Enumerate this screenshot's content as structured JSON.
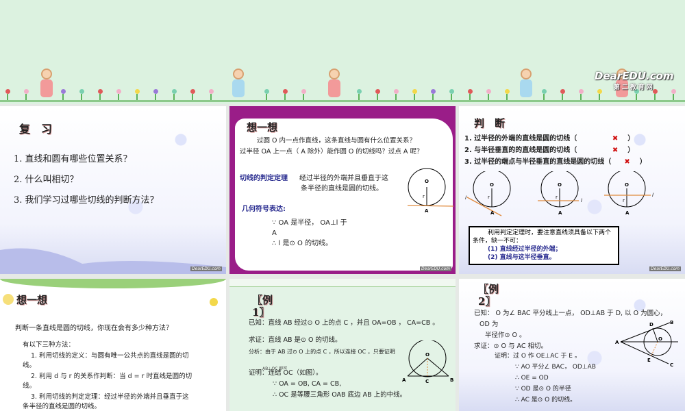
{
  "banner": {
    "logo": "DearEDU.com",
    "logo_sub": "第二教育网"
  },
  "slide1": {
    "title": "复　习",
    "items": [
      "1. 直线和圆有哪些位置关系？",
      "2. 什么叫相切？",
      "3. 我们学习过哪些切线的判断方法？"
    ]
  },
  "slide2": {
    "title": "想一想",
    "q1": "过圆 O 内一点作直线，这条直线与圆有什么位置关系？",
    "q2": "过半径 OA 上一点（ A 除外）能作圆 O 的切线吗？过点 A 呢？",
    "theorem_label": "切线的判定定理",
    "theorem_text1": "经过半径的外端并且垂直于这",
    "theorem_text2": "条半径的直线是圆的切线。",
    "symbol_label": "几何符号表达:",
    "line1": "∵ OA 是半径， OA⊥l 于",
    "line2": "A",
    "line3": "∴ l 是⊙ O 的切线。",
    "fig": {
      "o": "O",
      "r": "r",
      "a": "A"
    }
  },
  "slide3": {
    "title": "判　断",
    "items": [
      {
        "text": "1. 过半径的外端的直线是圆的切线（",
        "mark": "✖",
        "close": "）"
      },
      {
        "text": "2. 与半径垂直的的直线是圆的切线（",
        "mark": "✖",
        "close": "）"
      },
      {
        "text": "3. 过半径的端点与半径垂直的直线是圆的切线（",
        "mark": "✖",
        "close": "）"
      }
    ],
    "fig": {
      "o": "O",
      "r": "r",
      "a": "A",
      "l": "l"
    },
    "box1": "利用判定定理时，要注意直线须具备以下两个条件，缺一不可：",
    "box2": "(1) 直线经过半径的外端；",
    "box3": "(2) 直线与这半径垂直。"
  },
  "slide4": {
    "title": "想一想",
    "q": "判断一条直线是圆的切线，你现在会有多少种方法？",
    "intro": "有以下三种方法：",
    "m1": "1. 利用切线的定义：与圆有唯一公共点的直线是圆的切线。",
    "m2": "2. 利用 d 与 r 的关系作判断：当 d = r 时直线是圆的切线。",
    "m3": "3. 利用切线的判定定理：经过半径的外端并且垂直于这条半径的直线是圆的切线。"
  },
  "slide5": {
    "title1": "〖例",
    "title2": "1〗",
    "given": "已知：直线 AB 经过⊙ O 上的点 C ，并且 OA=OB ， CA=CB 。",
    "prove": "求证：直线 AB 是⊙ O 的切线。",
    "analysis": "分析：由于 AB 过⊙ O 上的点 C ，所以连接 OC ，只要证明",
    "analysis2": "AB⊥OC 即可",
    "proof": "证明：连结 OC（如图）。",
    "p1": "∵ OA = OB, CA = CB,",
    "p2": "∴ OC 是等腰三角形 OAB 底边 AB 上的中线。",
    "fig": {
      "o": "O",
      "a": "A",
      "b": "B",
      "c": "C"
    }
  },
  "slide6": {
    "title1": "〖例",
    "title2": "2〗",
    "given": "已知： O 为∠ BAC 平分线上一点， OD⊥AB 于 D, 以 O 为圆心，",
    "given2": "OD 为",
    "given3": "半径作⊙ O 。",
    "prove": "求证：⊙ O 与 AC 相切。",
    "proof": "证明：过 O 作 OE⊥AC 于 E 。",
    "p1": "∵ AO 平分∠ BAC， OD⊥AB",
    "p2": "∴ OE = OD",
    "p3": "∵ OD 是⊙ O 的半径",
    "p4": "∴ AC 是⊙ O 的切线。",
    "fig": {
      "a": "A",
      "b": "B",
      "c": "C",
      "d": "D",
      "e": "E",
      "o": "O"
    }
  },
  "watermark": "DearEDU.com"
}
